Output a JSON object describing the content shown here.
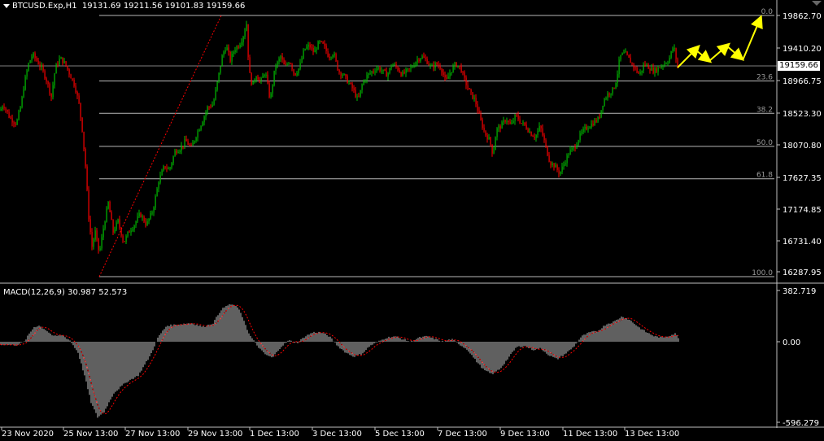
{
  "header": {
    "symbol": "BTCUSD.Exp,H1",
    "ohlc": "19131.69 19211.56 19101.83 19159.66"
  },
  "current_price": "19159.66",
  "macd_header": "MACD(12,26,9) 30.987 52.573",
  "colors": {
    "bull": "#00c000",
    "bear": "#ff0000",
    "wick": "#ffffff",
    "arrow": "#ffff00",
    "grid": "#c0c0c0",
    "macd_bar": "#c0c0c0",
    "signal": "#ff0000"
  },
  "chart_data": [
    {
      "type": "candlestick",
      "title": "BTCUSD.Exp,H1",
      "price_axis_ticks": [
        "19862.70",
        "19410.20",
        "18966.75",
        "18523.30",
        "18070.80",
        "17627.35",
        "17174.85",
        "16731.40",
        "16287.95"
      ],
      "x_tick_labels": [
        "23 Nov 2020",
        "25 Nov 13:00",
        "27 Nov 13:00",
        "29 Nov 13:00",
        "1 Dec 13:00",
        "3 Dec 13:00",
        "5 Dec 13:00",
        "7 Dec 13:00",
        "9 Dec 13:00",
        "11 Dec 13:00",
        "13 Dec 13:00"
      ],
      "ylim": [
        16220,
        19980
      ],
      "close_path": [
        {
          "x": 0,
          "y": 18560
        },
        {
          "x": 4,
          "y": 18650
        },
        {
          "x": 12,
          "y": 18460
        },
        {
          "x": 20,
          "y": 18380
        },
        {
          "x": 26,
          "y": 18650
        },
        {
          "x": 30,
          "y": 18950
        },
        {
          "x": 35,
          "y": 19200
        },
        {
          "x": 40,
          "y": 19330
        },
        {
          "x": 46,
          "y": 19230
        },
        {
          "x": 52,
          "y": 19120
        },
        {
          "x": 58,
          "y": 18950
        },
        {
          "x": 63,
          "y": 18750
        },
        {
          "x": 68,
          "y": 19150
        },
        {
          "x": 74,
          "y": 19280
        },
        {
          "x": 80,
          "y": 19200
        },
        {
          "x": 86,
          "y": 19050
        },
        {
          "x": 92,
          "y": 18900
        },
        {
          "x": 97,
          "y": 18650
        },
        {
          "x": 101,
          "y": 18300
        },
        {
          "x": 105,
          "y": 17800
        },
        {
          "x": 109,
          "y": 17100
        },
        {
          "x": 113,
          "y": 16700
        },
        {
          "x": 117,
          "y": 16900
        },
        {
          "x": 122,
          "y": 16600
        },
        {
          "x": 127,
          "y": 16950
        },
        {
          "x": 133,
          "y": 17300
        },
        {
          "x": 139,
          "y": 16900
        },
        {
          "x": 145,
          "y": 17050
        },
        {
          "x": 152,
          "y": 16750
        },
        {
          "x": 158,
          "y": 16900
        },
        {
          "x": 165,
          "y": 17000
        },
        {
          "x": 172,
          "y": 17150
        },
        {
          "x": 180,
          "y": 17000
        },
        {
          "x": 188,
          "y": 17200
        },
        {
          "x": 195,
          "y": 17600
        },
        {
          "x": 202,
          "y": 17800
        },
        {
          "x": 208,
          "y": 17750
        },
        {
          "x": 215,
          "y": 18000
        },
        {
          "x": 222,
          "y": 18050
        },
        {
          "x": 228,
          "y": 18150
        },
        {
          "x": 235,
          "y": 18050
        },
        {
          "x": 242,
          "y": 18250
        },
        {
          "x": 248,
          "y": 18400
        },
        {
          "x": 255,
          "y": 18600
        },
        {
          "x": 262,
          "y": 18650
        },
        {
          "x": 268,
          "y": 19000
        },
        {
          "x": 273,
          "y": 19300
        },
        {
          "x": 278,
          "y": 19450
        },
        {
          "x": 283,
          "y": 19250
        },
        {
          "x": 288,
          "y": 19400
        },
        {
          "x": 293,
          "y": 19450
        },
        {
          "x": 298,
          "y": 19550
        },
        {
          "x": 303,
          "y": 19750
        },
        {
          "x": 306,
          "y": 19100
        },
        {
          "x": 310,
          "y": 18900
        },
        {
          "x": 315,
          "y": 19050
        },
        {
          "x": 320,
          "y": 18950
        },
        {
          "x": 326,
          "y": 19100
        },
        {
          "x": 332,
          "y": 18700
        },
        {
          "x": 338,
          "y": 19150
        },
        {
          "x": 345,
          "y": 19300
        },
        {
          "x": 350,
          "y": 19150
        },
        {
          "x": 356,
          "y": 19250
        },
        {
          "x": 362,
          "y": 19050
        },
        {
          "x": 368,
          "y": 19150
        },
        {
          "x": 374,
          "y": 19400
        },
        {
          "x": 380,
          "y": 19450
        },
        {
          "x": 386,
          "y": 19350
        },
        {
          "x": 392,
          "y": 19500
        },
        {
          "x": 398,
          "y": 19450
        },
        {
          "x": 404,
          "y": 19300
        },
        {
          "x": 410,
          "y": 19350
        },
        {
          "x": 416,
          "y": 19100
        },
        {
          "x": 422,
          "y": 19050
        },
        {
          "x": 428,
          "y": 18950
        },
        {
          "x": 434,
          "y": 18850
        },
        {
          "x": 440,
          "y": 18700
        },
        {
          "x": 446,
          "y": 18950
        },
        {
          "x": 452,
          "y": 19050
        },
        {
          "x": 458,
          "y": 19100
        },
        {
          "x": 464,
          "y": 19150
        },
        {
          "x": 470,
          "y": 19100
        },
        {
          "x": 476,
          "y": 19050
        },
        {
          "x": 482,
          "y": 19200
        },
        {
          "x": 488,
          "y": 19150
        },
        {
          "x": 494,
          "y": 19050
        },
        {
          "x": 500,
          "y": 19100
        },
        {
          "x": 506,
          "y": 19150
        },
        {
          "x": 512,
          "y": 19250
        },
        {
          "x": 518,
          "y": 19300
        },
        {
          "x": 524,
          "y": 19250
        },
        {
          "x": 530,
          "y": 19150
        },
        {
          "x": 536,
          "y": 19200
        },
        {
          "x": 542,
          "y": 19150
        },
        {
          "x": 548,
          "y": 18950
        },
        {
          "x": 554,
          "y": 19100
        },
        {
          "x": 560,
          "y": 19200
        },
        {
          "x": 566,
          "y": 19150
        },
        {
          "x": 572,
          "y": 18950
        },
        {
          "x": 578,
          "y": 18800
        },
        {
          "x": 584,
          "y": 18700
        },
        {
          "x": 590,
          "y": 18450
        },
        {
          "x": 596,
          "y": 18250
        },
        {
          "x": 602,
          "y": 18150
        },
        {
          "x": 606,
          "y": 17950
        },
        {
          "x": 610,
          "y": 18300
        },
        {
          "x": 616,
          "y": 18350
        },
        {
          "x": 622,
          "y": 18450
        },
        {
          "x": 628,
          "y": 18350
        },
        {
          "x": 634,
          "y": 18500
        },
        {
          "x": 640,
          "y": 18400
        },
        {
          "x": 646,
          "y": 18350
        },
        {
          "x": 652,
          "y": 18250
        },
        {
          "x": 658,
          "y": 18200
        },
        {
          "x": 664,
          "y": 18350
        },
        {
          "x": 670,
          "y": 18100
        },
        {
          "x": 676,
          "y": 17850
        },
        {
          "x": 682,
          "y": 17800
        },
        {
          "x": 688,
          "y": 17700
        },
        {
          "x": 694,
          "y": 17850
        },
        {
          "x": 700,
          "y": 18000
        },
        {
          "x": 706,
          "y": 18050
        },
        {
          "x": 712,
          "y": 18200
        },
        {
          "x": 718,
          "y": 18300
        },
        {
          "x": 724,
          "y": 18350
        },
        {
          "x": 730,
          "y": 18400
        },
        {
          "x": 736,
          "y": 18450
        },
        {
          "x": 742,
          "y": 18700
        },
        {
          "x": 748,
          "y": 18800
        },
        {
          "x": 754,
          "y": 18850
        },
        {
          "x": 758,
          "y": 19000
        },
        {
          "x": 762,
          "y": 19300
        },
        {
          "x": 768,
          "y": 19350
        },
        {
          "x": 774,
          "y": 19250
        },
        {
          "x": 780,
          "y": 19150
        },
        {
          "x": 786,
          "y": 19050
        },
        {
          "x": 792,
          "y": 19200
        },
        {
          "x": 798,
          "y": 19150
        },
        {
          "x": 804,
          "y": 19100
        },
        {
          "x": 810,
          "y": 19150
        },
        {
          "x": 816,
          "y": 19200
        },
        {
          "x": 822,
          "y": 19250
        },
        {
          "x": 828,
          "y": 19450
        },
        {
          "x": 833,
          "y": 19159.66
        }
      ],
      "fibonacci": {
        "levels": [
          {
            "label": "0.0",
            "price": 19862.7
          },
          {
            "label": "23.6",
            "price": 18966.75
          },
          {
            "label": "38.2",
            "price": 18523.3
          },
          {
            "label": "50.0",
            "price": 18070.8
          },
          {
            "label": "61.8",
            "price": 17627.35
          },
          {
            "label": "100.0",
            "price": 16287.95
          }
        ]
      },
      "trendline": {
        "from": {
          "x": 122,
          "y": 16287.95
        },
        "to": {
          "x": 272,
          "y": 19862.7
        }
      },
      "projection_arrows": [
        {
          "from": {
            "x": 833,
            "y": 19150
          },
          "to": {
            "x": 858,
            "y": 19430
          }
        },
        {
          "from": {
            "x": 852,
            "y": 19420
          },
          "to": {
            "x": 872,
            "y": 19240
          }
        },
        {
          "from": {
            "x": 872,
            "y": 19240
          },
          "to": {
            "x": 895,
            "y": 19460
          }
        },
        {
          "from": {
            "x": 893,
            "y": 19450
          },
          "to": {
            "x": 912,
            "y": 19270
          }
        },
        {
          "from": {
            "x": 913,
            "y": 19250
          },
          "to": {
            "x": 935,
            "y": 19830
          }
        }
      ]
    },
    {
      "type": "bar",
      "title": "MACD(12,26,9) 30.987 52.573",
      "axis_ticks": [
        "382.719",
        "0.00",
        "-596.279"
      ],
      "ylim": [
        -596.279,
        382.719
      ],
      "histogram_path": [
        {
          "x": 0,
          "y": -20
        },
        {
          "x": 20,
          "y": -25
        },
        {
          "x": 30,
          "y": 0
        },
        {
          "x": 36,
          "y": 60
        },
        {
          "x": 42,
          "y": 110
        },
        {
          "x": 48,
          "y": 120
        },
        {
          "x": 56,
          "y": 90
        },
        {
          "x": 66,
          "y": 40
        },
        {
          "x": 76,
          "y": 50
        },
        {
          "x": 86,
          "y": 10
        },
        {
          "x": 96,
          "y": -80
        },
        {
          "x": 104,
          "y": -250
        },
        {
          "x": 112,
          "y": -450
        },
        {
          "x": 120,
          "y": -560
        },
        {
          "x": 128,
          "y": -520
        },
        {
          "x": 140,
          "y": -380
        },
        {
          "x": 155,
          "y": -300
        },
        {
          "x": 170,
          "y": -250
        },
        {
          "x": 185,
          "y": -100
        },
        {
          "x": 195,
          "y": 40
        },
        {
          "x": 205,
          "y": 120
        },
        {
          "x": 220,
          "y": 130
        },
        {
          "x": 235,
          "y": 140
        },
        {
          "x": 250,
          "y": 110
        },
        {
          "x": 262,
          "y": 140
        },
        {
          "x": 272,
          "y": 240
        },
        {
          "x": 282,
          "y": 280
        },
        {
          "x": 292,
          "y": 260
        },
        {
          "x": 300,
          "y": 160
        },
        {
          "x": 306,
          "y": 60
        },
        {
          "x": 315,
          "y": -20
        },
        {
          "x": 325,
          "y": -90
        },
        {
          "x": 335,
          "y": -120
        },
        {
          "x": 345,
          "y": -40
        },
        {
          "x": 355,
          "y": 10
        },
        {
          "x": 365,
          "y": -10
        },
        {
          "x": 375,
          "y": 40
        },
        {
          "x": 385,
          "y": 70
        },
        {
          "x": 395,
          "y": 70
        },
        {
          "x": 405,
          "y": 40
        },
        {
          "x": 415,
          "y": -30
        },
        {
          "x": 425,
          "y": -80
        },
        {
          "x": 435,
          "y": -110
        },
        {
          "x": 445,
          "y": -90
        },
        {
          "x": 455,
          "y": -30
        },
        {
          "x": 465,
          "y": 0
        },
        {
          "x": 475,
          "y": 30
        },
        {
          "x": 485,
          "y": 40
        },
        {
          "x": 495,
          "y": 20
        },
        {
          "x": 505,
          "y": 0
        },
        {
          "x": 515,
          "y": 30
        },
        {
          "x": 525,
          "y": 40
        },
        {
          "x": 535,
          "y": 20
        },
        {
          "x": 545,
          "y": 0
        },
        {
          "x": 555,
          "y": 20
        },
        {
          "x": 565,
          "y": -20
        },
        {
          "x": 575,
          "y": -60
        },
        {
          "x": 585,
          "y": -140
        },
        {
          "x": 595,
          "y": -210
        },
        {
          "x": 605,
          "y": -240
        },
        {
          "x": 615,
          "y": -200
        },
        {
          "x": 625,
          "y": -120
        },
        {
          "x": 635,
          "y": -40
        },
        {
          "x": 645,
          "y": -30
        },
        {
          "x": 655,
          "y": -60
        },
        {
          "x": 665,
          "y": -50
        },
        {
          "x": 675,
          "y": -100
        },
        {
          "x": 685,
          "y": -130
        },
        {
          "x": 695,
          "y": -90
        },
        {
          "x": 705,
          "y": -40
        },
        {
          "x": 715,
          "y": 40
        },
        {
          "x": 725,
          "y": 70
        },
        {
          "x": 735,
          "y": 80
        },
        {
          "x": 745,
          "y": 130
        },
        {
          "x": 755,
          "y": 150
        },
        {
          "x": 765,
          "y": 190
        },
        {
          "x": 775,
          "y": 160
        },
        {
          "x": 785,
          "y": 110
        },
        {
          "x": 795,
          "y": 70
        },
        {
          "x": 805,
          "y": 40
        },
        {
          "x": 815,
          "y": 30
        },
        {
          "x": 825,
          "y": 50
        },
        {
          "x": 830,
          "y": 60
        },
        {
          "x": 834,
          "y": 31
        }
      ],
      "signal_lag": 6
    }
  ]
}
